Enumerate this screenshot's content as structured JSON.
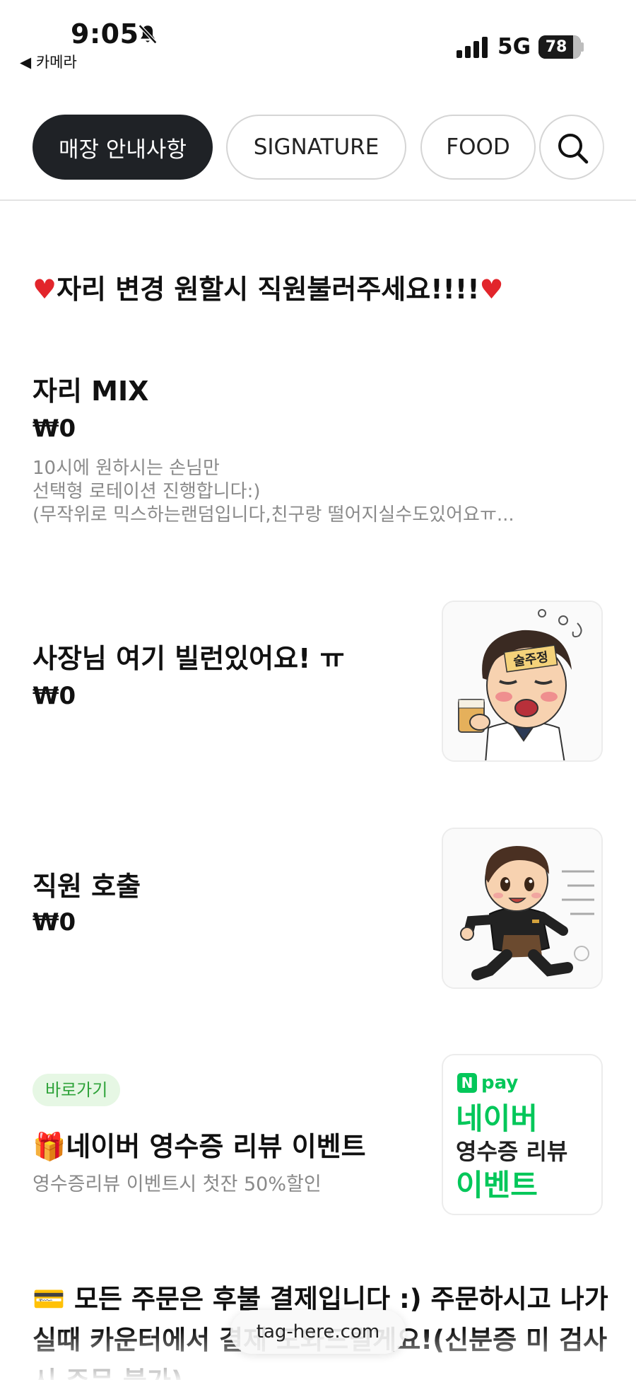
{
  "status_bar": {
    "time": "9:05",
    "back_label": "◀ 카메라",
    "network": "5G",
    "battery": "78",
    "battery_level_percent": 78
  },
  "tabs": [
    {
      "label": "매장 안내사항",
      "active": true
    },
    {
      "label": "SIGNATURE",
      "active": false
    },
    {
      "label": "FOOD",
      "active": false
    }
  ],
  "notice": {
    "heart_left": "♥",
    "text": "자리 변경 원할시 직원불러주세요!!!!",
    "heart_right": "♥"
  },
  "items": [
    {
      "name": "자리 MIX",
      "price": "₩0",
      "description": [
        "10시에 원하시는 손님만",
        "선택형 로테이션 진행합니다:)",
        "(무작위로 믹스하는랜덤입니다,친구랑 떨어지실수도있어요ㅠ..."
      ]
    },
    {
      "name": "사장님 여기 빌런있어요! ㅠ",
      "price": "₩0",
      "image_label": "술주정"
    },
    {
      "name": "직원 호출",
      "price": "₩0"
    }
  ],
  "event": {
    "badge": "바로가기",
    "icon": "🎁",
    "title": "네이버 영수증 리뷰 이벤트",
    "description": "영수증리뷰 이벤트시 첫잔 50%할인",
    "image": {
      "logo_n": "N",
      "logo_pay": "pay",
      "line1": "네이버",
      "line2": "영수증 리뷰",
      "line3": "이벤트"
    }
  },
  "bottom_notice": {
    "icon": "💳",
    "text": "모든 주문은 후불 결제입니다 :) 주문하시고 나가실때 카운터에서 결제 도와드릴게요!(신분증 미 검사 시 주문 불가)"
  },
  "url": "tag-here.com",
  "colors": {
    "active_tab": "#1f2226",
    "heart": "#e2252b",
    "naver_green": "#03c75a",
    "badge_bg": "#e6f7e4",
    "badge_text": "#2fa33a"
  }
}
